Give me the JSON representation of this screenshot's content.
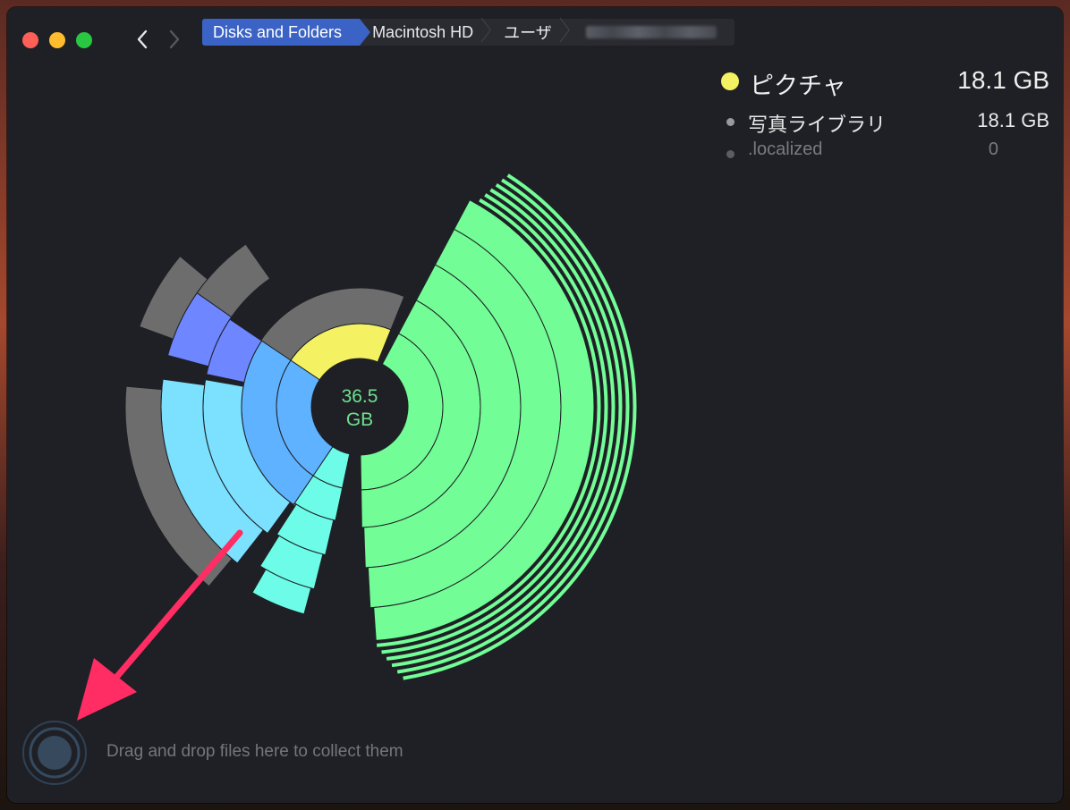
{
  "window": {
    "breadcrumb": [
      "Disks and Folders",
      "Macintosh HD",
      "ユーザ"
    ],
    "nav": {
      "back_icon": "chevron-left-icon",
      "forward_icon": "chevron-right-icon"
    }
  },
  "legend": {
    "selected": {
      "name": "ピクチャ",
      "size": "18.1 GB",
      "color": "#f4f162"
    },
    "children": [
      {
        "name": "写真ライブラリ",
        "size": "18.1 GB"
      },
      {
        "name": ".localized",
        "size": "0"
      }
    ]
  },
  "chart_center": {
    "value": "36.5",
    "unit": "GB"
  },
  "collector": {
    "hint": "Drag and drop files here to collect them",
    "icon": "collector-icon"
  },
  "colors": {
    "window_bg": "#1f2025",
    "accent_blue": "#3b63c5",
    "segment_green": "#72fd96",
    "segment_yellow": "#f4f162",
    "segment_gray": "#6d6d6d",
    "segment_blue": "#5fb2ff",
    "segment_cyan": "#7ce0ff",
    "segment_aqua": "#6cfce7",
    "segment_indigo": "#6e86ff",
    "annotation_arrow": "#ff2d63"
  }
}
